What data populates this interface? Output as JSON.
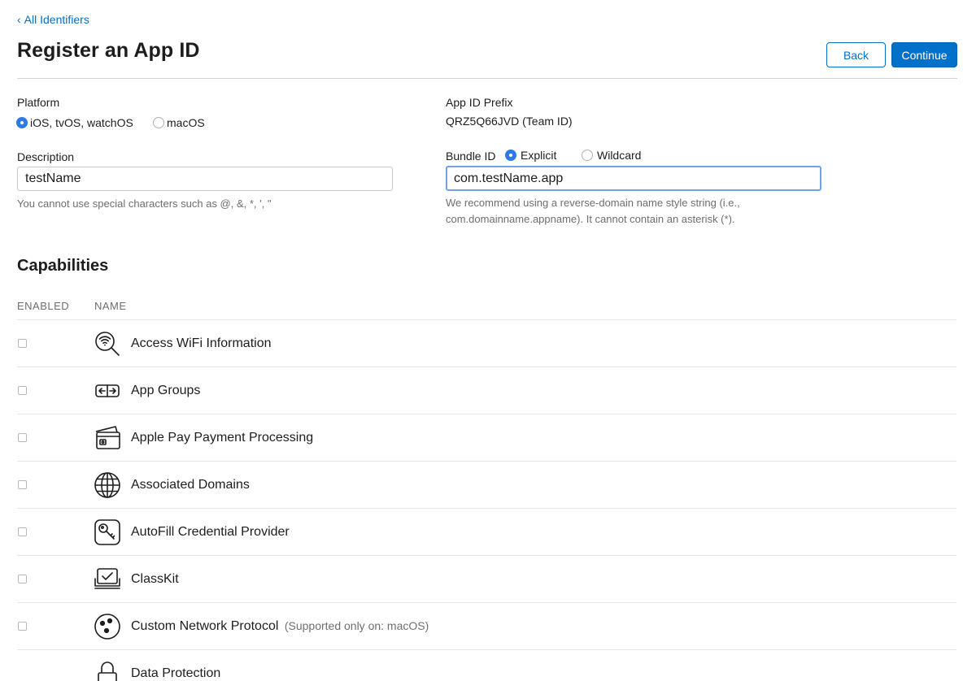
{
  "nav": {
    "back_chevron": "‹",
    "back_label": "All Identifiers"
  },
  "header": {
    "title": "Register an App ID",
    "back_button": "Back",
    "continue_button": "Continue"
  },
  "platform": {
    "label": "Platform",
    "options": [
      {
        "label": "iOS, tvOS, watchOS",
        "selected": true
      },
      {
        "label": "macOS",
        "selected": false
      }
    ]
  },
  "prefix": {
    "label": "App ID Prefix",
    "value": "QRZ5Q66JVD (Team ID)"
  },
  "description": {
    "label": "Description",
    "value": "testName",
    "help": "You cannot use special characters such as @, &, *, ', \""
  },
  "bundle": {
    "label": "Bundle ID",
    "options": [
      {
        "label": "Explicit",
        "selected": true
      },
      {
        "label": "Wildcard",
        "selected": false
      }
    ],
    "value": "com.testName.app",
    "help_line1": "We recommend using a reverse-domain name style string (i.e.,",
    "help_line2": "com.domainname.appname). It cannot contain an asterisk (*)."
  },
  "capabilities": {
    "title": "Capabilities",
    "col_enabled": "ENABLED",
    "col_name": "NAME",
    "items": [
      {
        "name": "Access WiFi Information",
        "note": "",
        "icon": "wifi-search-icon",
        "enabled": false
      },
      {
        "name": "App Groups",
        "note": "",
        "icon": "app-groups-icon",
        "enabled": false
      },
      {
        "name": "Apple Pay Payment Processing",
        "note": "",
        "icon": "wallet-card-icon",
        "enabled": false
      },
      {
        "name": "Associated Domains",
        "note": "",
        "icon": "globe-icon",
        "enabled": false
      },
      {
        "name": "AutoFill Credential Provider",
        "note": "",
        "icon": "key-icon",
        "enabled": false
      },
      {
        "name": "ClassKit",
        "note": "",
        "icon": "classkit-icon",
        "enabled": false
      },
      {
        "name": "Custom Network Protocol",
        "note": "(Supported only on: macOS)",
        "icon": "network-nodes-icon",
        "enabled": false
      },
      {
        "name": "Data Protection",
        "note": "",
        "icon": "lock-icon",
        "enabled": false
      }
    ]
  }
}
